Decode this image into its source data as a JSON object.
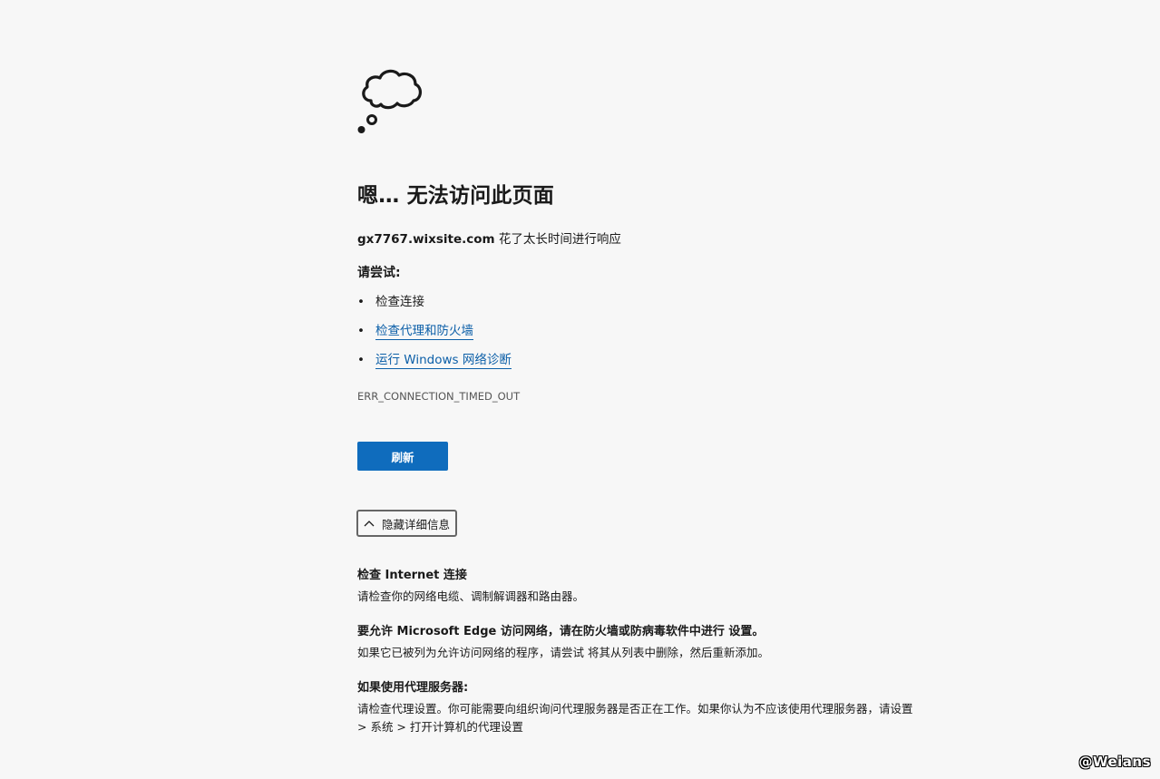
{
  "error_page": {
    "icon": "thought-cloud-icon",
    "title": "嗯… 无法访问此页面",
    "host": "gx7767.wixsite.com",
    "host_message": "花了太长时间进行响应",
    "try_label": "请尝试:",
    "suggestions": [
      {
        "label": "检查连接",
        "link": false
      },
      {
        "label": "检查代理和防火墙",
        "link": true
      },
      {
        "label": "运行 Windows 网络诊断",
        "link": true
      }
    ],
    "bullet": "•",
    "error_code": "ERR_CONNECTION_TIMED_OUT",
    "refresh_label": "刷新",
    "details_toggle_label": "隐藏详细信息",
    "details": [
      {
        "heading": "检查 Internet 连接",
        "body": "请检查你的网络电缆、调制解调器和路由器。"
      },
      {
        "heading": "要允许 Microsoft Edge 访问网络，请在防火墙或防病毒软件中进行 设置。",
        "body": "如果它已被列为允许访问网络的程序，请尝试 将其从列表中删除，然后重新添加。"
      },
      {
        "heading": "如果使用代理服务器:",
        "body": "请检查代理设置。你可能需要向组织询问代理服务器是否正在工作。如果你认为不应该使用代理服务器，请设置 > 系统 > 打开计算机的代理设置"
      }
    ]
  },
  "watermark": "@Weians",
  "colors": {
    "background": "#f7f7f7",
    "accent_button": "#0f6cbd",
    "link": "#0c5fa8"
  }
}
